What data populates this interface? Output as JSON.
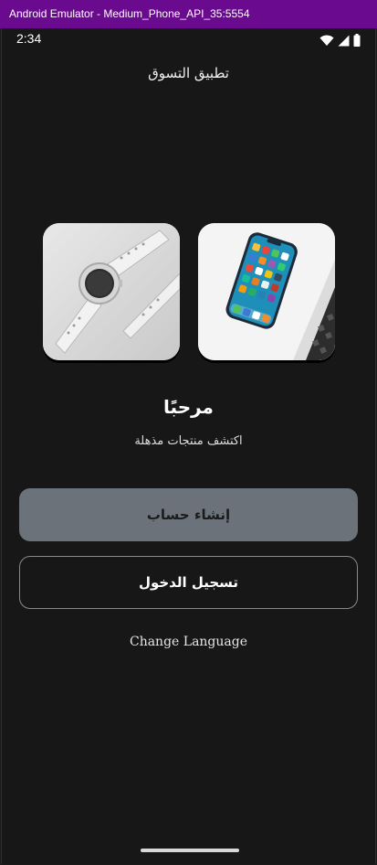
{
  "window": {
    "title": "Android Emulator - Medium_Phone_API_35:5554"
  },
  "status_bar": {
    "time": "2:34",
    "icons": [
      "wifi-icon",
      "signal-icon",
      "battery-icon"
    ]
  },
  "app": {
    "title": "تطبيق التسوق"
  },
  "products": [
    {
      "name": "watch-image"
    },
    {
      "name": "phone-image"
    }
  ],
  "welcome": {
    "heading": "مرحبًا",
    "subtitle": "اكتشف منتجات مذهلة"
  },
  "buttons": {
    "create_account": "إنشاء حساب",
    "login": "تسجيل الدخول",
    "change_language": "Change Language"
  },
  "colors": {
    "titlebar": "#6a0a8e",
    "background": "#171717",
    "primary_button": "#6b727a",
    "outline_border": "#8a8a8a"
  }
}
